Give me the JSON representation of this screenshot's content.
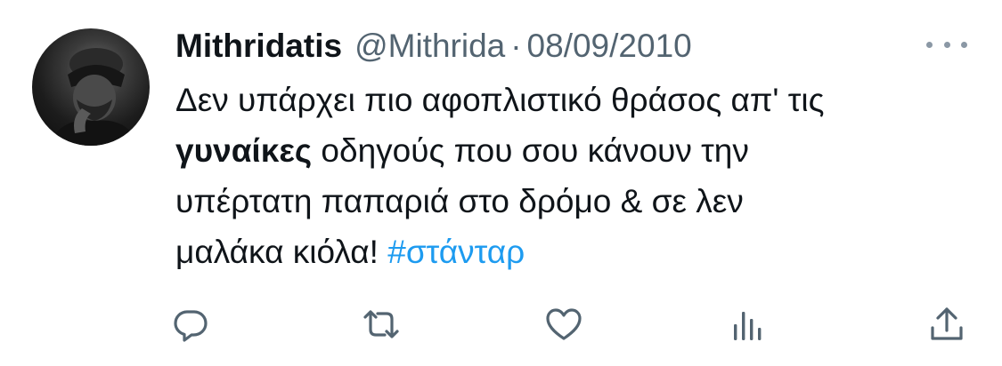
{
  "author": {
    "name": "Mithridatis",
    "handle": "@Mithrida",
    "separator": "·",
    "date": "08/09/2010"
  },
  "tweet": {
    "line1": "Δεν υπάρχει πιο αφοπλιστικό θράσος απ' τις",
    "line2_bold": "γυναίκες",
    "line2_rest": " οδηγούς που σου κάνουν την",
    "line3": "υπέρτατη παπαριά στο δρόμο & σε λεν",
    "line4_text": "μαλάκα κιόλα! ",
    "hashtag": "#στάνταρ"
  },
  "icons": {
    "more": "more-horizontal-icon",
    "reply": "reply-icon",
    "retweet": "retweet-icon",
    "like": "heart-icon",
    "views": "views-icon",
    "share": "share-icon"
  },
  "colors": {
    "text": "#0f1419",
    "secondary": "#536471",
    "icon": "#536471",
    "hashtag": "#1d9bf0"
  }
}
